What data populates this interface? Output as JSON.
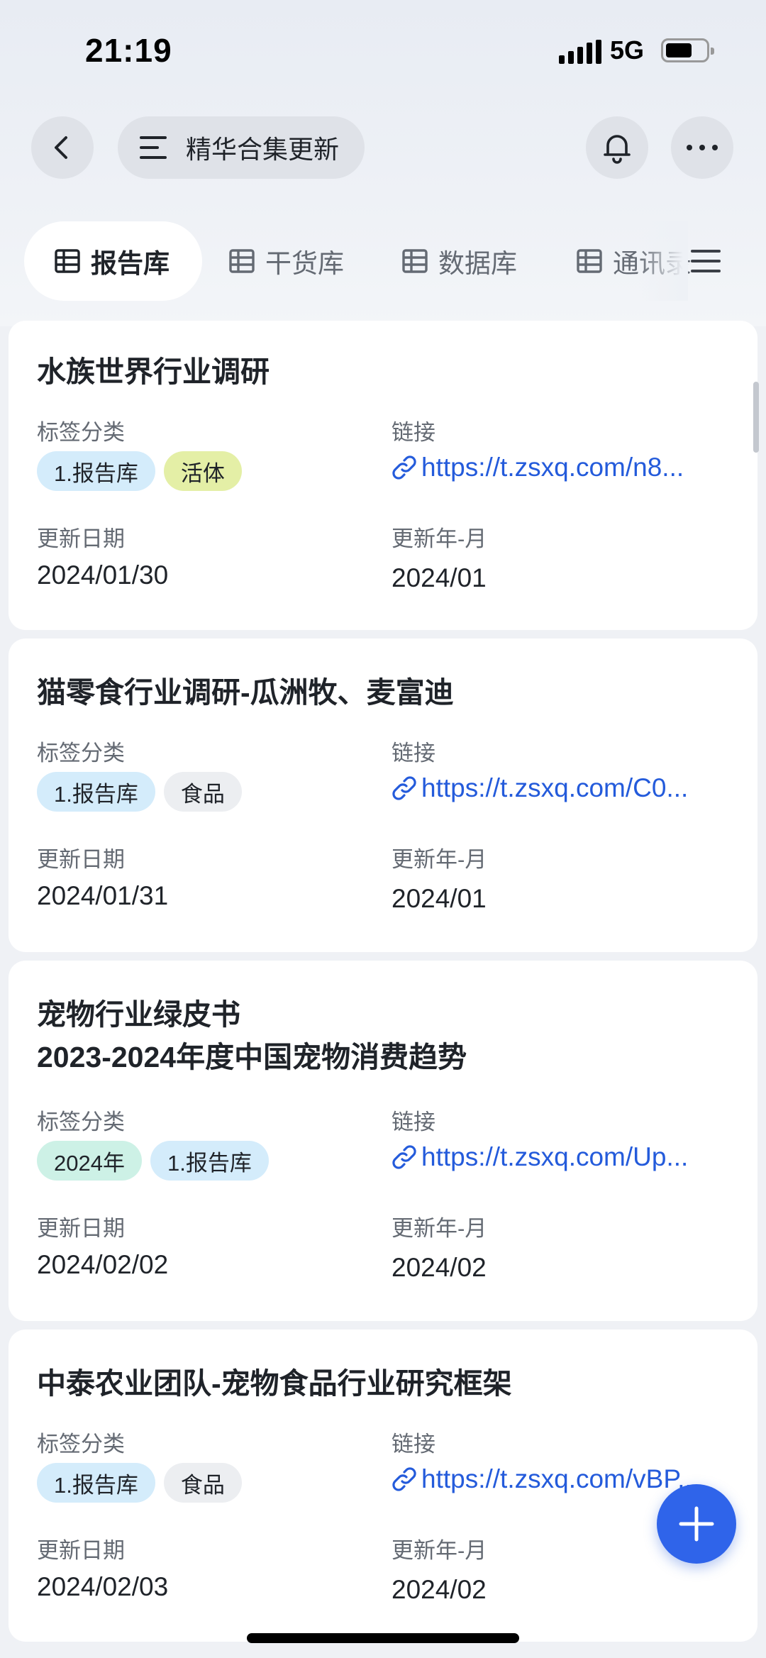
{
  "status_bar": {
    "time": "21:19",
    "network": "5G"
  },
  "header": {
    "title": "精华合集更新"
  },
  "tabs": [
    {
      "label": "报告库",
      "active": true
    },
    {
      "label": "干货库",
      "active": false
    },
    {
      "label": "数据库",
      "active": false
    },
    {
      "label": "通讯录",
      "active": false
    }
  ],
  "field_labels": {
    "tags": "标签分类",
    "link": "链接",
    "update_date": "更新日期",
    "update_month": "更新年-月"
  },
  "records": [
    {
      "title": "水族世界行业调研",
      "tags": [
        {
          "label": "1.报告库",
          "color": "#d4ecfb"
        },
        {
          "label": "活体",
          "color": "#e4efa6"
        }
      ],
      "link": "https://t.zsxq.com/n8...",
      "update_date": "2024/01/30",
      "update_month": "2024/01"
    },
    {
      "title": "猫零食行业调研-瓜洲牧、麦富迪",
      "tags": [
        {
          "label": "1.报告库",
          "color": "#d4ecfb"
        },
        {
          "label": "食品",
          "color": "#eceef1"
        }
      ],
      "link": "https://t.zsxq.com/C0...",
      "update_date": "2024/01/31",
      "update_month": "2024/01"
    },
    {
      "title_line1": "宠物行业绿皮书",
      "title_line2": "2023-2024年度中国宠物消费趋势",
      "tags": [
        {
          "label": "2024年",
          "color": "#cdf1e6"
        },
        {
          "label": "1.报告库",
          "color": "#d4ecfb"
        }
      ],
      "link": "https://t.zsxq.com/Up...",
      "update_date": "2024/02/02",
      "update_month": "2024/02"
    },
    {
      "title": "中泰农业团队-宠物食品行业研究框架",
      "tags": [
        {
          "label": "1.报告库",
          "color": "#d4ecfb"
        },
        {
          "label": "食品",
          "color": "#eceef1"
        }
      ],
      "link": "https://t.zsxq.com/vBP...",
      "update_date": "2024/02/03",
      "update_month": "2024/02"
    }
  ],
  "colors": {
    "accent": "#2f64ea",
    "link": "#245bdb"
  },
  "icons": [
    "back-icon",
    "menu-icon",
    "bell-icon",
    "more-icon",
    "table-icon",
    "hamburger-icon",
    "link-icon",
    "plus-icon"
  ]
}
